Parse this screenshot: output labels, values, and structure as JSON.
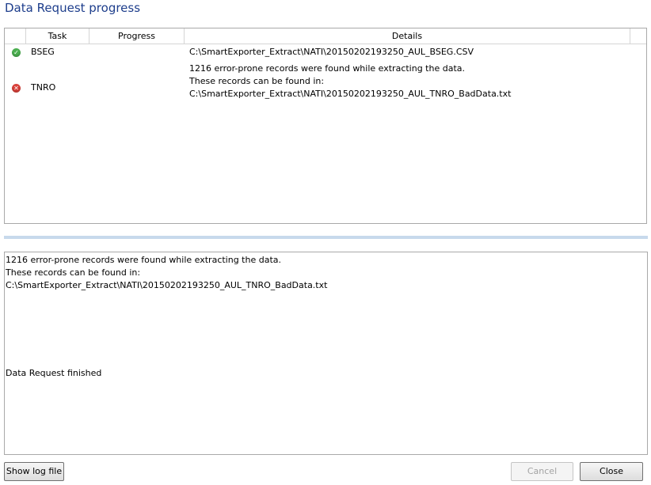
{
  "window": {
    "title": "Data Request progress"
  },
  "grid": {
    "columns": {
      "task": "Task",
      "progress": "Progress",
      "details": "Details"
    },
    "rows": [
      {
        "status": "success",
        "status_icon": "check-icon",
        "task": "BSEG",
        "details": [
          "C:\\SmartExporter_Extract\\NATI\\20150202193250_AUL_BSEG.CSV"
        ]
      },
      {
        "status": "error",
        "status_icon": "error-icon",
        "task": "TNRO",
        "details": [
          "1216 error-prone records were found while extracting the data.",
          "These records can be found in:",
          "C:\\SmartExporter_Extract\\NATI\\20150202193250_AUL_TNRO_BadData.txt"
        ]
      }
    ]
  },
  "log": {
    "lines": [
      "1216 error-prone records were found while extracting the data.",
      "These records can be found in:",
      "C:\\SmartExporter_Extract\\NATI\\20150202193250_AUL_TNRO_BadData.txt",
      "Data Request finished"
    ]
  },
  "buttons": {
    "show_log": "Show log file",
    "cancel": "Cancel",
    "close": "Close"
  },
  "colors": {
    "title": "#1e3e8c",
    "success": "#4caf50",
    "error": "#d9413a",
    "splitter": "#c7d9ec"
  }
}
